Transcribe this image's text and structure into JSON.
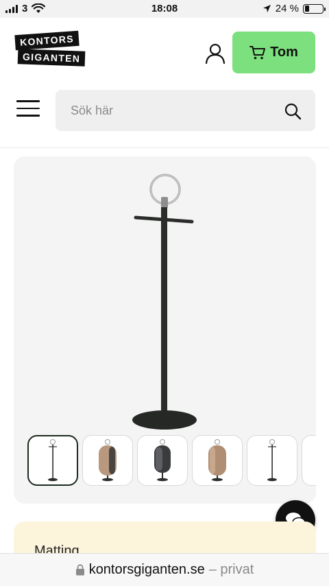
{
  "status_bar": {
    "carrier": "3",
    "time": "18:08",
    "battery": "24 %",
    "battery_level": 0.24
  },
  "header": {
    "logo_line1": "KONTORS",
    "logo_line2": "GIGANTEN",
    "account_icon": "user-icon",
    "cart_label": "Tom",
    "cart_icon": "cart-icon",
    "menu_icon": "hamburger-menu-icon",
    "search_placeholder": "Sök här",
    "search_icon": "search-icon"
  },
  "product": {
    "image": "coat-stand-with-ring",
    "thumbnails": [
      {
        "image": "coat-stand",
        "active": true
      },
      {
        "image": "mirror-stand-rattan",
        "active": false
      },
      {
        "image": "mirror-stand-dark",
        "active": false
      },
      {
        "image": "mirror-stand-rattan",
        "active": false
      },
      {
        "image": "coat-stand",
        "active": false
      },
      {
        "image": "mirror-stand-dark-partial",
        "active": false
      }
    ]
  },
  "chat_icon": "chat-bubbles-icon",
  "info_section": {
    "label": "Matting"
  },
  "url_bar": {
    "lock_icon": "lock-icon",
    "domain": "kontorsgiganten.se",
    "suffix": "– privat"
  },
  "colors": {
    "cart_green": "#7de07e",
    "card_bg": "#f4f4f4",
    "info_bg": "#fdf4dc",
    "stand_dark": "#2b2d2b"
  }
}
